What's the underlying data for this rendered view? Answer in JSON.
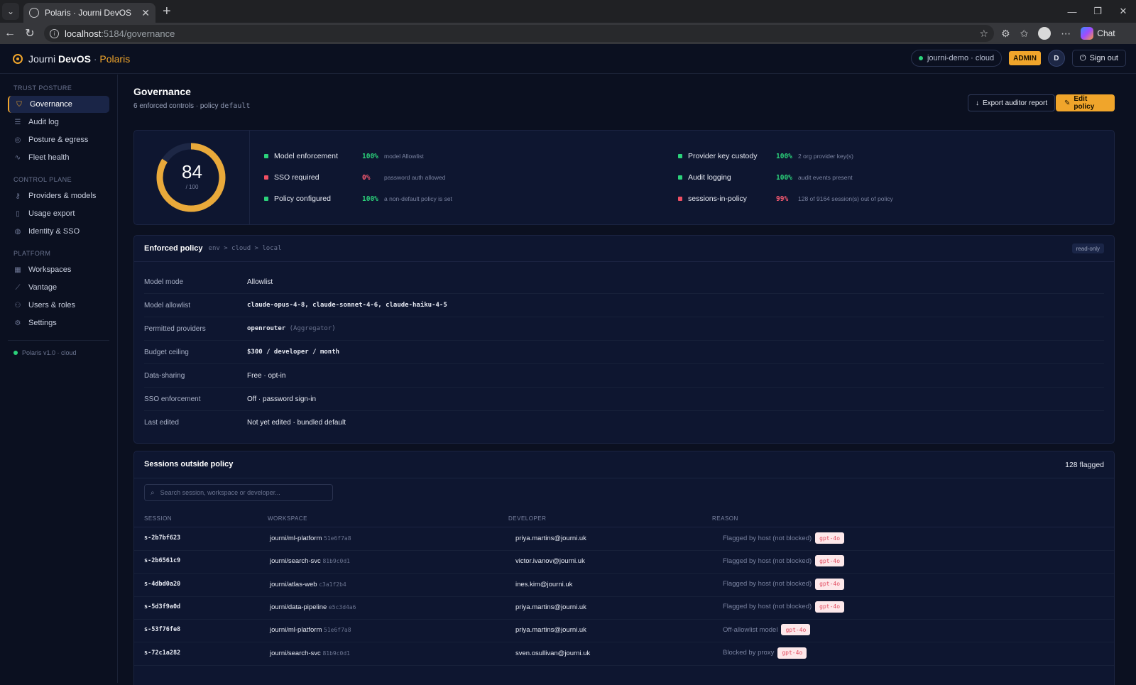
{
  "browser": {
    "tab_title": "Polaris · Journi DevOS",
    "url_host": "localhost",
    "url_path": ":5184/governance",
    "chat_label": "Chat"
  },
  "app": {
    "brand_prefix": "Journi",
    "brand_bold": "DevOS",
    "brand_sep": " · ",
    "brand_product": "Polaris",
    "env": "journi-demo · cloud",
    "role_badge": "ADMIN",
    "user_initial": "D",
    "sign_out": "Sign out"
  },
  "sidebar": {
    "sections": [
      {
        "title": "TRUST POSTURE",
        "items": [
          {
            "label": "Governance",
            "icon": "shield-icon",
            "active": true
          },
          {
            "label": "Audit log",
            "icon": "list-icon"
          },
          {
            "label": "Posture & egress",
            "icon": "target-icon"
          },
          {
            "label": "Fleet health",
            "icon": "pulse-icon"
          }
        ]
      },
      {
        "title": "CONTROL PLANE",
        "items": [
          {
            "label": "Providers & models",
            "icon": "key-icon"
          },
          {
            "label": "Usage export",
            "icon": "file-icon"
          },
          {
            "label": "Identity & SSO",
            "icon": "fingerprint-icon"
          }
        ]
      },
      {
        "title": "PLATFORM",
        "items": [
          {
            "label": "Workspaces",
            "icon": "grid-icon"
          },
          {
            "label": "Vantage",
            "icon": "chart-icon"
          },
          {
            "label": "Users & roles",
            "icon": "users-icon"
          },
          {
            "label": "Settings",
            "icon": "gear-icon"
          }
        ]
      }
    ],
    "footer": "Polaris v1.0 · cloud"
  },
  "header": {
    "title": "Governance",
    "subtitle_prefix": "6 enforced controls · policy ",
    "policy_name": "default",
    "export_label": "Export auditor report",
    "edit_label": "Edit policy"
  },
  "score": {
    "value": "84",
    "max": "/ 100",
    "fraction": 0.84,
    "controls": [
      {
        "label": "Model enforcement",
        "pct": "100%",
        "note": "model Allowlist",
        "status": "ok"
      },
      {
        "label": "SSO required",
        "pct": "0%",
        "note": "password auth allowed",
        "status": "bad"
      },
      {
        "label": "Policy configured",
        "pct": "100%",
        "note": "a non-default policy is set",
        "status": "ok"
      },
      {
        "label": "Provider key custody",
        "pct": "100%",
        "note": "2 org provider key(s)",
        "status": "ok"
      },
      {
        "label": "Audit logging",
        "pct": "100%",
        "note": "audit events present",
        "status": "ok"
      },
      {
        "label": "sessions-in-policy",
        "pct": "99%",
        "note": "128 of 9164 session(s) out of policy",
        "status": "bad"
      }
    ]
  },
  "policy": {
    "title": "Enforced policy",
    "chain": "env > cloud > local",
    "badge": "read-only",
    "rows": [
      {
        "key": "Model mode",
        "value": "Allowlist"
      },
      {
        "key": "Model allowlist",
        "value": "claude-opus-4-8, claude-sonnet-4-6, claude-haiku-4-5"
      },
      {
        "key": "Permitted providers",
        "value": "openrouter",
        "extra": "(Aggregator)"
      },
      {
        "key": "Budget ceiling",
        "value": "$300 / developer / month"
      },
      {
        "key": "Data-sharing",
        "value": "Free · opt-in"
      },
      {
        "key": "SSO enforcement",
        "value": "Off · password sign-in"
      },
      {
        "key": "Last edited",
        "value": "Not yet edited · bundled default"
      }
    ]
  },
  "sessions": {
    "title": "Sessions outside policy",
    "flagged": "128 flagged",
    "search_placeholder": "Search session, workspace or developer...",
    "columns": [
      "SESSION",
      "WORKSPACE",
      "DEVELOPER",
      "REASON"
    ],
    "rows": [
      {
        "session": "s-2b7bf623",
        "workspace": "journi/ml-platform",
        "hash": "51e6f7a8",
        "developer": "priya.martins@journi.uk",
        "reason": "Flagged by host (not blocked)",
        "model": "gpt-4o"
      },
      {
        "session": "s-2b6561c9",
        "workspace": "journi/search-svc",
        "hash": "81b9c0d1",
        "developer": "victor.ivanov@journi.uk",
        "reason": "Flagged by host (not blocked)",
        "model": "gpt-4o"
      },
      {
        "session": "s-4dbd0a20",
        "workspace": "journi/atlas-web",
        "hash": "c3a1f2b4",
        "developer": "ines.kim@journi.uk",
        "reason": "Flagged by host (not blocked)",
        "model": "gpt-4o"
      },
      {
        "session": "s-5d3f9a0d",
        "workspace": "journi/data-pipeline",
        "hash": "e5c3d4a6",
        "developer": "priya.martins@journi.uk",
        "reason": "Flagged by host (not blocked)",
        "model": "gpt-4o"
      },
      {
        "session": "s-53f76fe8",
        "workspace": "journi/ml-platform",
        "hash": "51e6f7a8",
        "developer": "priya.martins@journi.uk",
        "reason": "Off-allowlist model",
        "model": "gpt-4o"
      },
      {
        "session": "s-72c1a282",
        "workspace": "journi/search-svc",
        "hash": "81b9c0d1",
        "developer": "sven.osullivan@journi.uk",
        "reason": "Blocked by proxy",
        "model": "gpt-4o"
      }
    ]
  },
  "colors": {
    "accent": "#f0a52b",
    "ok": "#2bd27a",
    "bad": "#f04f63",
    "background": "#0b1020"
  }
}
